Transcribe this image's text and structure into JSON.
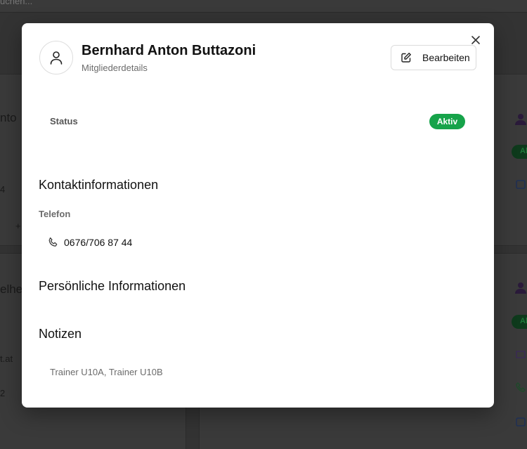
{
  "background": {
    "search_text": "uchen...",
    "left_fragments": [
      "nto",
      "4",
      "+",
      "elhe",
      "t.at",
      "2"
    ],
    "badge_fragment": "Al"
  },
  "modal": {
    "title": "Bernhard Anton Buttazoni",
    "subtitle": "Mitgliederdetails",
    "edit_label": "Bearbeiten",
    "status_label": "Status",
    "status_value": "Aktiv",
    "status_color": "#16a34a",
    "contact_section": "Kontaktinformationen",
    "phone_label": "Telefon",
    "phone_value": "0676/706 87 44",
    "personal_section": "Persönliche Informationen",
    "notes_section": "Notizen",
    "notes_text": "Trainer U10A, Trainer U10B"
  }
}
